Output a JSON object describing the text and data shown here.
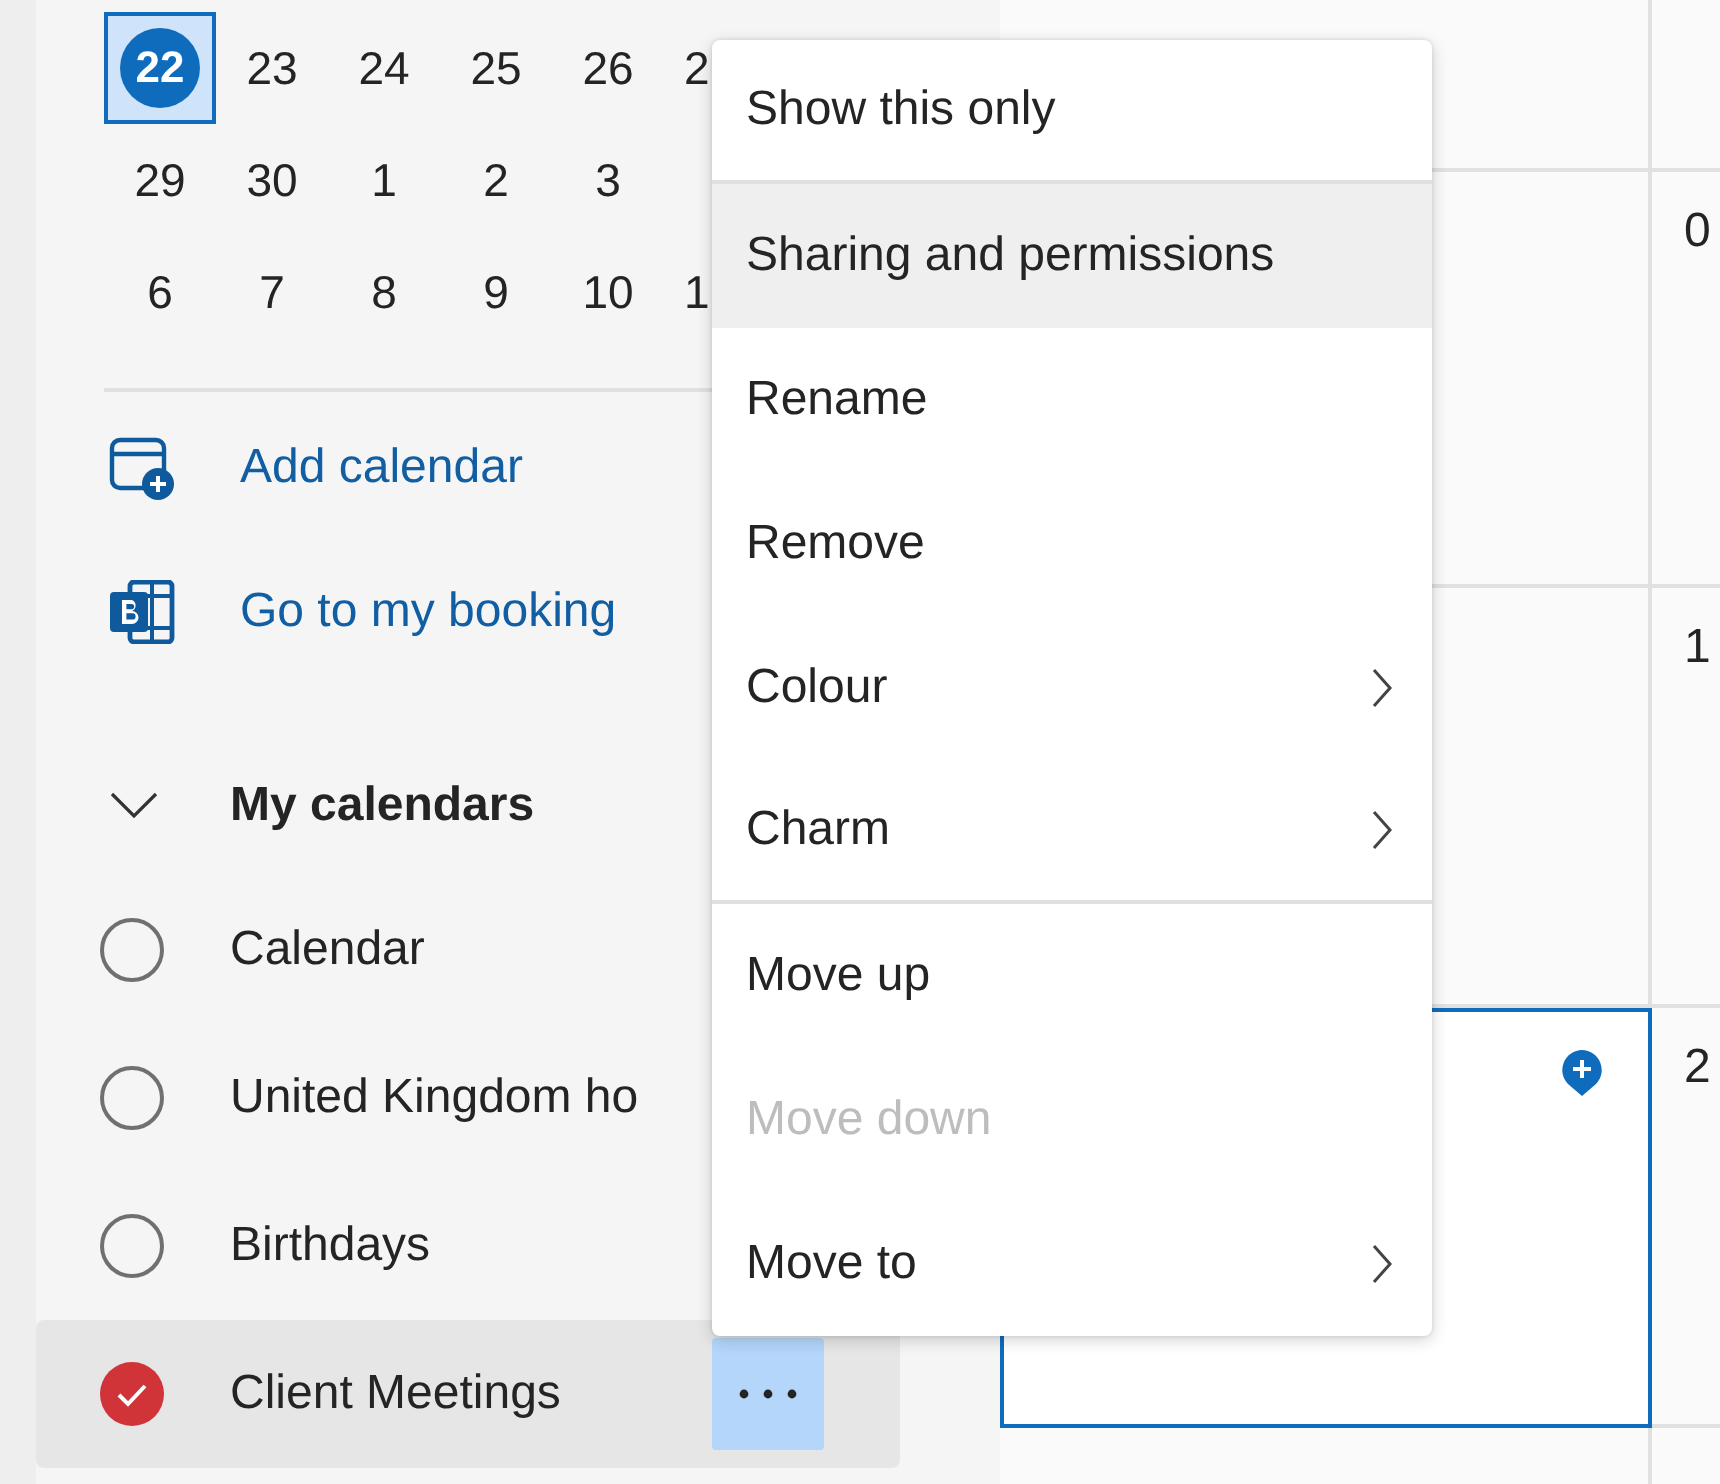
{
  "mini_calendar": {
    "weeks": [
      [
        {
          "day": "22",
          "selected": true
        },
        {
          "day": "23",
          "selected": false
        },
        {
          "day": "24",
          "selected": false
        },
        {
          "day": "25",
          "selected": false
        },
        {
          "day": "26",
          "selected": false
        },
        {
          "day": "2",
          "selected": false
        }
      ],
      [
        {
          "day": "29",
          "selected": false
        },
        {
          "day": "30",
          "selected": false
        },
        {
          "day": "1",
          "selected": false
        },
        {
          "day": "2",
          "selected": false
        },
        {
          "day": "3",
          "selected": false
        }
      ],
      [
        {
          "day": "6",
          "selected": false
        },
        {
          "day": "7",
          "selected": false
        },
        {
          "day": "8",
          "selected": false
        },
        {
          "day": "9",
          "selected": false
        },
        {
          "day": "10",
          "selected": false
        },
        {
          "day": "1",
          "selected": false
        }
      ]
    ]
  },
  "actions": [
    {
      "kind": "add-calendar",
      "label": "Add calendar"
    },
    {
      "kind": "booking",
      "label": "Go to my booking"
    }
  ],
  "my_calendars": {
    "title": "My calendars",
    "expanded": true,
    "items": [
      {
        "name": "Calendar",
        "checked": false,
        "selected": false
      },
      {
        "name": "United Kingdom ho",
        "checked": false,
        "selected": false
      },
      {
        "name": "Birthdays",
        "checked": false,
        "selected": false
      },
      {
        "name": "Client Meetings",
        "checked": true,
        "selected": true
      }
    ]
  },
  "context_menu": {
    "items": [
      {
        "label": "Show this only",
        "disabled": false,
        "hovered": false,
        "submenu": false,
        "divider_after": true
      },
      {
        "label": "Sharing and permissions",
        "disabled": false,
        "hovered": true,
        "submenu": false,
        "divider_after": false
      },
      {
        "label": "Rename",
        "disabled": false,
        "hovered": false,
        "submenu": false,
        "divider_after": false
      },
      {
        "label": "Remove",
        "disabled": false,
        "hovered": false,
        "submenu": false,
        "divider_after": false
      },
      {
        "label": "Colour",
        "disabled": false,
        "hovered": false,
        "submenu": true,
        "divider_after": false
      },
      {
        "label": "Charm",
        "disabled": false,
        "hovered": false,
        "submenu": true,
        "divider_after": true
      },
      {
        "label": "Move up",
        "disabled": false,
        "hovered": false,
        "submenu": false,
        "divider_after": false
      },
      {
        "label": "Move down",
        "disabled": true,
        "hovered": false,
        "submenu": false,
        "divider_after": false
      },
      {
        "label": "Move to",
        "disabled": false,
        "hovered": false,
        "submenu": true,
        "divider_after": false
      }
    ]
  },
  "day_grid": {
    "rows": [
      {
        "focused": false
      },
      {
        "day": "0",
        "focused": false
      },
      {
        "day": "1",
        "focused": false
      },
      {
        "day": "2",
        "focused": true
      },
      {
        "focused": false
      }
    ]
  }
}
